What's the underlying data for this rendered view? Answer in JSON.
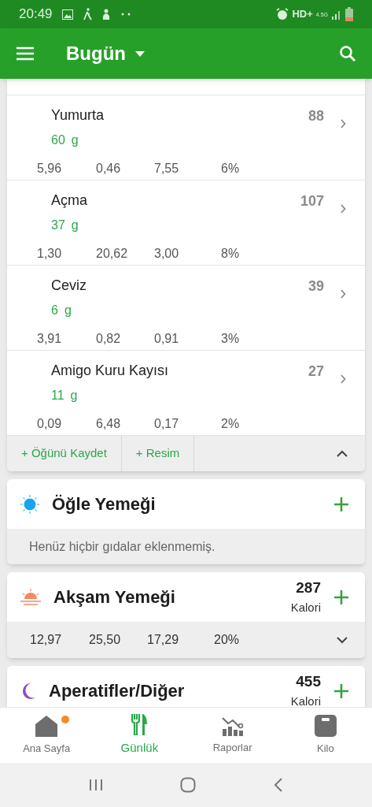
{
  "status_bar": {
    "time": "20:49",
    "network": "HD+",
    "network_type": "4.5G"
  },
  "app_bar": {
    "title": "Bugün"
  },
  "breakfast": {
    "expanded": true,
    "foods": [
      {
        "name": "Yumurta",
        "amount": "60",
        "unit": "g",
        "calories": "88",
        "macros": [
          "5,96",
          "0,46",
          "7,55",
          "6%"
        ]
      },
      {
        "name": "Açma",
        "amount": "37",
        "unit": "g",
        "calories": "107",
        "macros": [
          "1,30",
          "20,62",
          "3,00",
          "8%"
        ]
      },
      {
        "name": "Ceviz",
        "amount": "6",
        "unit": "g",
        "calories": "39",
        "macros": [
          "3,91",
          "0,82",
          "0,91",
          "3%"
        ]
      },
      {
        "name": "Amigo Kuru Kayısı",
        "amount": "11",
        "unit": "g",
        "calories": "27",
        "macros": [
          "0,09",
          "6,48",
          "0,17",
          "2%"
        ]
      }
    ],
    "actions": [
      "+ Öğünü Kaydet",
      "+ Resim"
    ]
  },
  "meals": [
    {
      "kind": "empty",
      "title": "Öğle Yemeği",
      "note": "Henüz hiçbir gıdalar eklenmemiş."
    },
    {
      "kind": "summary",
      "title": "Akşam Yemeği",
      "calories": "287",
      "calories_label": "Kalori",
      "expanded": false,
      "macros": [
        "12,97",
        "25,50",
        "17,29",
        "20%"
      ]
    },
    {
      "kind": "summary",
      "title": "Aperatifler/Diğer",
      "calories": "455",
      "calories_label": "Kalori"
    }
  ],
  "bottom_nav": [
    {
      "label": "Ana Sayfa",
      "selected": false,
      "badge": true
    },
    {
      "label": "Günlük",
      "selected": true,
      "badge": false
    },
    {
      "label": "Raporlar",
      "selected": false,
      "badge": false
    },
    {
      "label": "Kilo",
      "selected": false,
      "badge": false
    }
  ]
}
